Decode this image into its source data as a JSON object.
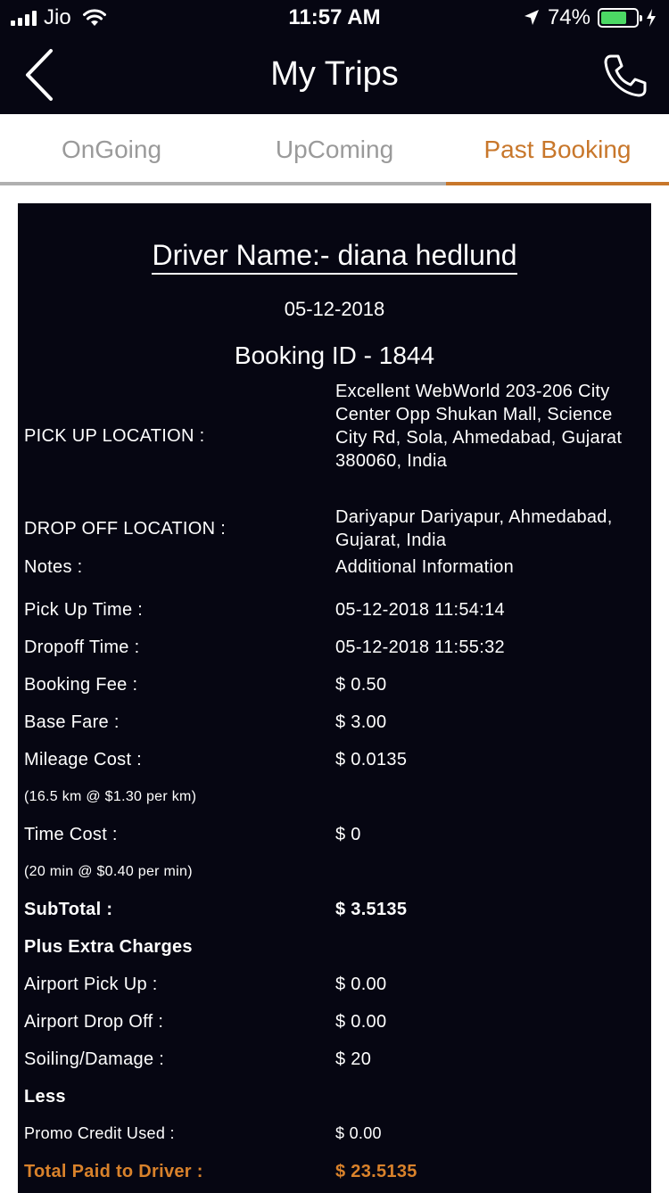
{
  "status_bar": {
    "carrier": "Jio",
    "time": "11:57 AM",
    "battery_pct": "74%",
    "battery_level": 0.74,
    "icons": [
      "signal-icon",
      "wifi-icon",
      "location-arrow-icon",
      "battery-icon",
      "charging-icon"
    ]
  },
  "nav": {
    "title": "My Trips",
    "back_icon": "chevron-left-icon",
    "call_icon": "phone-icon"
  },
  "tabs": [
    {
      "label": "OnGoing",
      "active": false
    },
    {
      "label": "UpComing",
      "active": false
    },
    {
      "label": "Past Booking",
      "active": true
    }
  ],
  "colors": {
    "accent": "#c8772b",
    "card_bg": "#060612",
    "battery_green": "#4cd964"
  },
  "trip": {
    "driver_name": "Driver Name:- diana hedlund",
    "date": "05-12-2018",
    "booking_id": "Booking ID - 1844",
    "pickup_label": "PICK UP LOCATION :",
    "pickup_value": "Excellent WebWorld 203-206 City Center Opp Shukan Mall, Science City Rd, Sola, Ahmedabad, Gujarat 380060, India",
    "dropoff_label": "DROP OFF LOCATION :",
    "dropoff_value": "Dariyapur Dariyapur, Ahmedabad, Gujarat, India",
    "notes_label": "Notes :",
    "notes_value": "Additional Information",
    "pickup_time_label": "Pick Up Time :",
    "pickup_time_value": "05-12-2018 11:54:14",
    "dropoff_time_label": "Dropoff Time :",
    "dropoff_time_value": "05-12-2018 11:55:32",
    "booking_fee_label": "Booking Fee :",
    "booking_fee_value": "$ 0.50",
    "base_fare_label": "Base Fare :",
    "base_fare_value": "$ 3.00",
    "mileage_label": "Mileage Cost :",
    "mileage_value": "$ 0.0135",
    "mileage_detail": "(16.5 km @ $1.30 per km)",
    "time_cost_label": "Time Cost :",
    "time_cost_value": "$ 0",
    "time_detail": "(20 min @ $0.40 per min)",
    "subtotal_label": "SubTotal :",
    "subtotal_value": "$ 3.5135",
    "extra_header": "Plus Extra Charges",
    "airport_pickup_label": "Airport Pick Up :",
    "airport_pickup_value": "$ 0.00",
    "airport_dropoff_label": "Airport Drop Off :",
    "airport_dropoff_value": "$ 0.00",
    "soiling_label": "Soiling/Damage :",
    "soiling_value": "$ 20",
    "less_header": "Less",
    "promo_label": "Promo Credit Used :",
    "promo_value": "$ 0.00",
    "total_label": "Total Paid to Driver :",
    "total_value": "$ 23.5135"
  }
}
